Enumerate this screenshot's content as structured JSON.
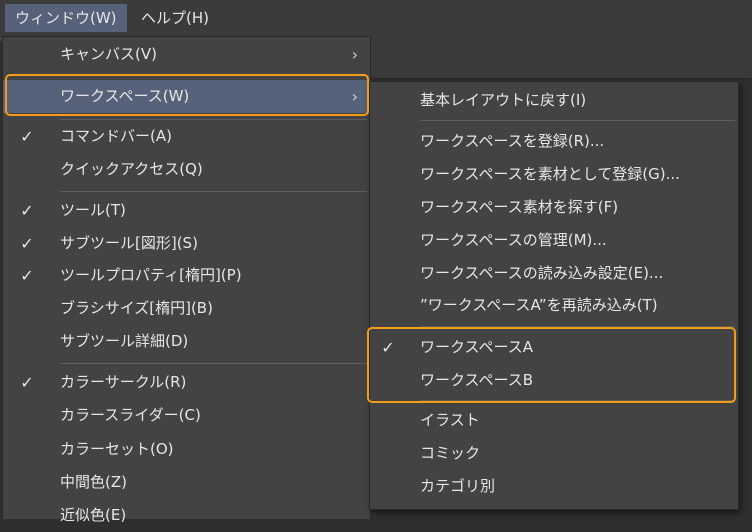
{
  "menubar": {
    "window": "ウィンドウ(W)",
    "help": "ヘルプ(H)"
  },
  "main_menu": {
    "canvas": "キャンバス(V)",
    "workspace": "ワークスペース(W)",
    "command_bar": "コマンドバー(A)",
    "quick_access": "クイックアクセス(Q)",
    "tool": "ツール(T)",
    "sub_tool": "サブツール[図形](S)",
    "tool_property": "ツールプロパティ[楕円](P)",
    "brush_size": "ブラシサイズ[楕円](B)",
    "sub_tool_detail": "サブツール詳細(D)",
    "color_circle": "カラーサークル(R)",
    "color_slider": "カラースライダー(C)",
    "color_set": "カラーセット(O)",
    "intermediate_color": "中間色(Z)",
    "approx_color": "近似色(E)"
  },
  "sub_menu": {
    "reset_layout": "基本レイアウトに戻す(I)",
    "register": "ワークスペースを登録(R)...",
    "register_material": "ワークスペースを素材として登録(G)...",
    "find_material": "ワークスペース素材を探す(F)",
    "manage": "ワークスペースの管理(M)...",
    "load_settings": "ワークスペースの読み込み設定(E)...",
    "reload_a": "”ワークスペースA”を再読み込み(T)",
    "workspace_a": "ワークスペースA",
    "workspace_b": "ワークスペースB",
    "illust": "イラスト",
    "comic": "コミック",
    "by_category": "カテゴリ別"
  },
  "symbols": {
    "check": "✓",
    "arrow": "›"
  },
  "colors": {
    "highlight": "#56627a",
    "callout": "#f49b1a",
    "menu_bg": "#434343"
  }
}
